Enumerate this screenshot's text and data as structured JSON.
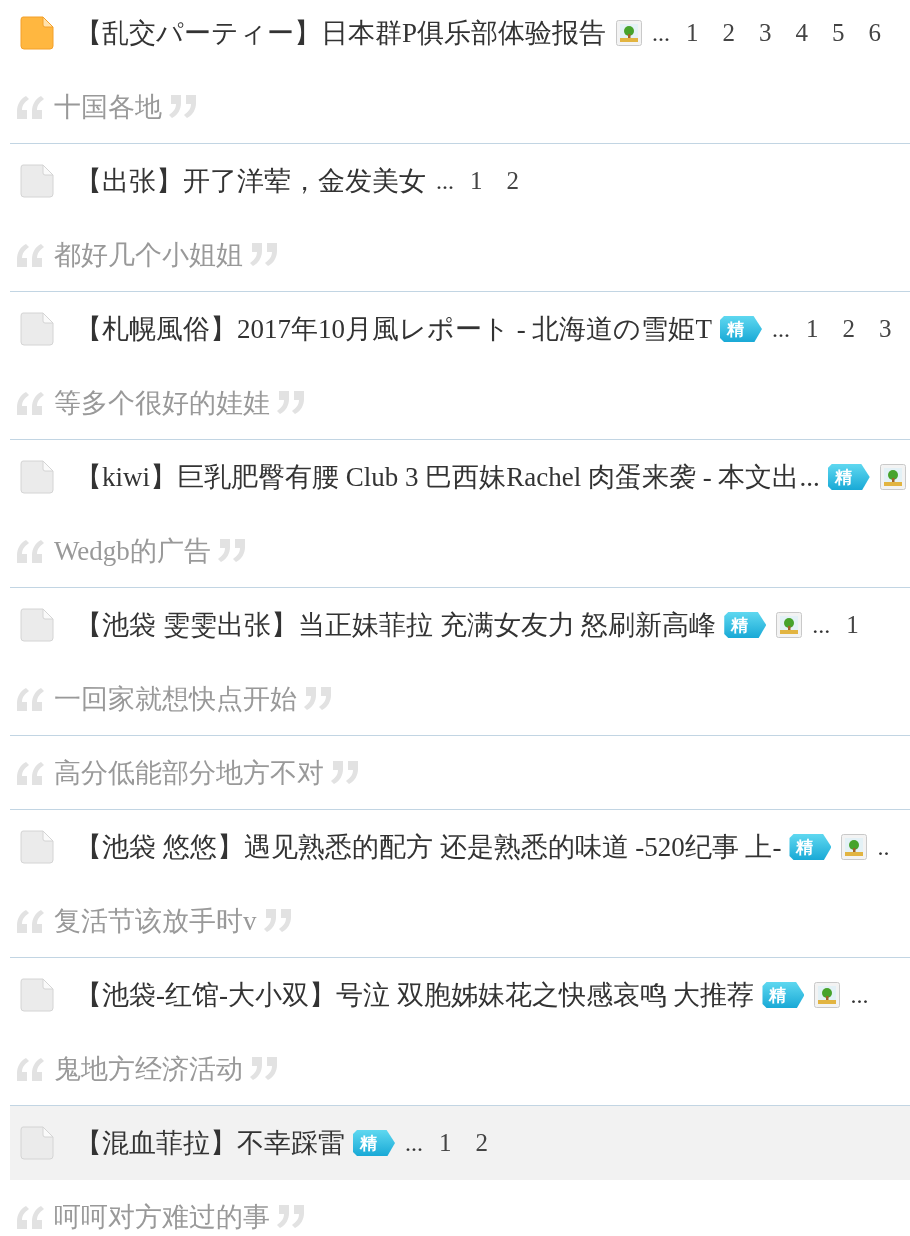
{
  "threads": [
    {
      "kind": "thread",
      "new": true,
      "highlighted": false,
      "title": "【乱交パーティー】日本群P俱乐部体验报告",
      "badges": [
        {
          "kind": "image"
        }
      ],
      "ellipsis": "...",
      "pages": [
        "1",
        "2",
        "3",
        "4",
        "5",
        "6"
      ]
    },
    {
      "kind": "reply",
      "text": "十国各地"
    },
    {
      "kind": "thread",
      "new": false,
      "highlighted": false,
      "title": "【出张】开了洋荤，金发美女",
      "ellipsis": "...",
      "pages": [
        "1",
        "2"
      ]
    },
    {
      "kind": "reply",
      "text": "都好几个小姐姐"
    },
    {
      "kind": "thread",
      "new": false,
      "highlighted": false,
      "title": "【札幌風俗】2017年10月風レポート - 北海道の雪姫T",
      "badges": [
        {
          "kind": "digest",
          "label": "精"
        }
      ],
      "ellipsis": "...",
      "pages": [
        "1",
        "2",
        "3"
      ]
    },
    {
      "kind": "reply",
      "text": "等多个很好的娃娃"
    },
    {
      "kind": "thread",
      "new": false,
      "highlighted": false,
      "title": "【kiwi】巨乳肥臀有腰 Club 3 巴西妹Rachel 肉蛋来袭 - 本文出...",
      "badges": [
        {
          "kind": "digest",
          "label": "精"
        },
        {
          "kind": "image"
        }
      ]
    },
    {
      "kind": "reply",
      "text": "Wedgb的广告"
    },
    {
      "kind": "thread",
      "new": false,
      "highlighted": false,
      "title": "【池袋 雯雯出张】当正妹菲拉 充满女友力 怒刷新高峰",
      "badges": [
        {
          "kind": "digest",
          "label": "精"
        },
        {
          "kind": "image"
        }
      ],
      "ellipsis": "...",
      "pages": [
        "1"
      ]
    },
    {
      "kind": "reply",
      "text": "一回家就想快点开始"
    },
    {
      "kind": "reply",
      "text": "高分低能部分地方不对"
    },
    {
      "kind": "thread",
      "new": false,
      "highlighted": false,
      "title": "【池袋 悠悠】遇见熟悉的配方 还是熟悉的味道 -520纪事 上-",
      "badges": [
        {
          "kind": "digest",
          "label": "精"
        },
        {
          "kind": "image"
        }
      ],
      "ellipsis": ".."
    },
    {
      "kind": "reply",
      "text": "复活节该放手时v"
    },
    {
      "kind": "thread",
      "new": false,
      "highlighted": false,
      "title": "【池袋-红馆-大小双】号泣 双胞姊妹花之快感哀鸣 大推荐",
      "badges": [
        {
          "kind": "digest",
          "label": "精"
        },
        {
          "kind": "image"
        }
      ],
      "ellipsis": "..."
    },
    {
      "kind": "reply",
      "text": "鬼地方经济活动"
    },
    {
      "kind": "thread",
      "new": false,
      "highlighted": true,
      "title": "【混血菲拉】不幸踩雷",
      "badges": [
        {
          "kind": "digest",
          "label": "精"
        }
      ],
      "ellipsis": "...",
      "pages": [
        "1",
        "2"
      ]
    },
    {
      "kind": "reply",
      "text": "呵呵对方难过的事"
    }
  ]
}
